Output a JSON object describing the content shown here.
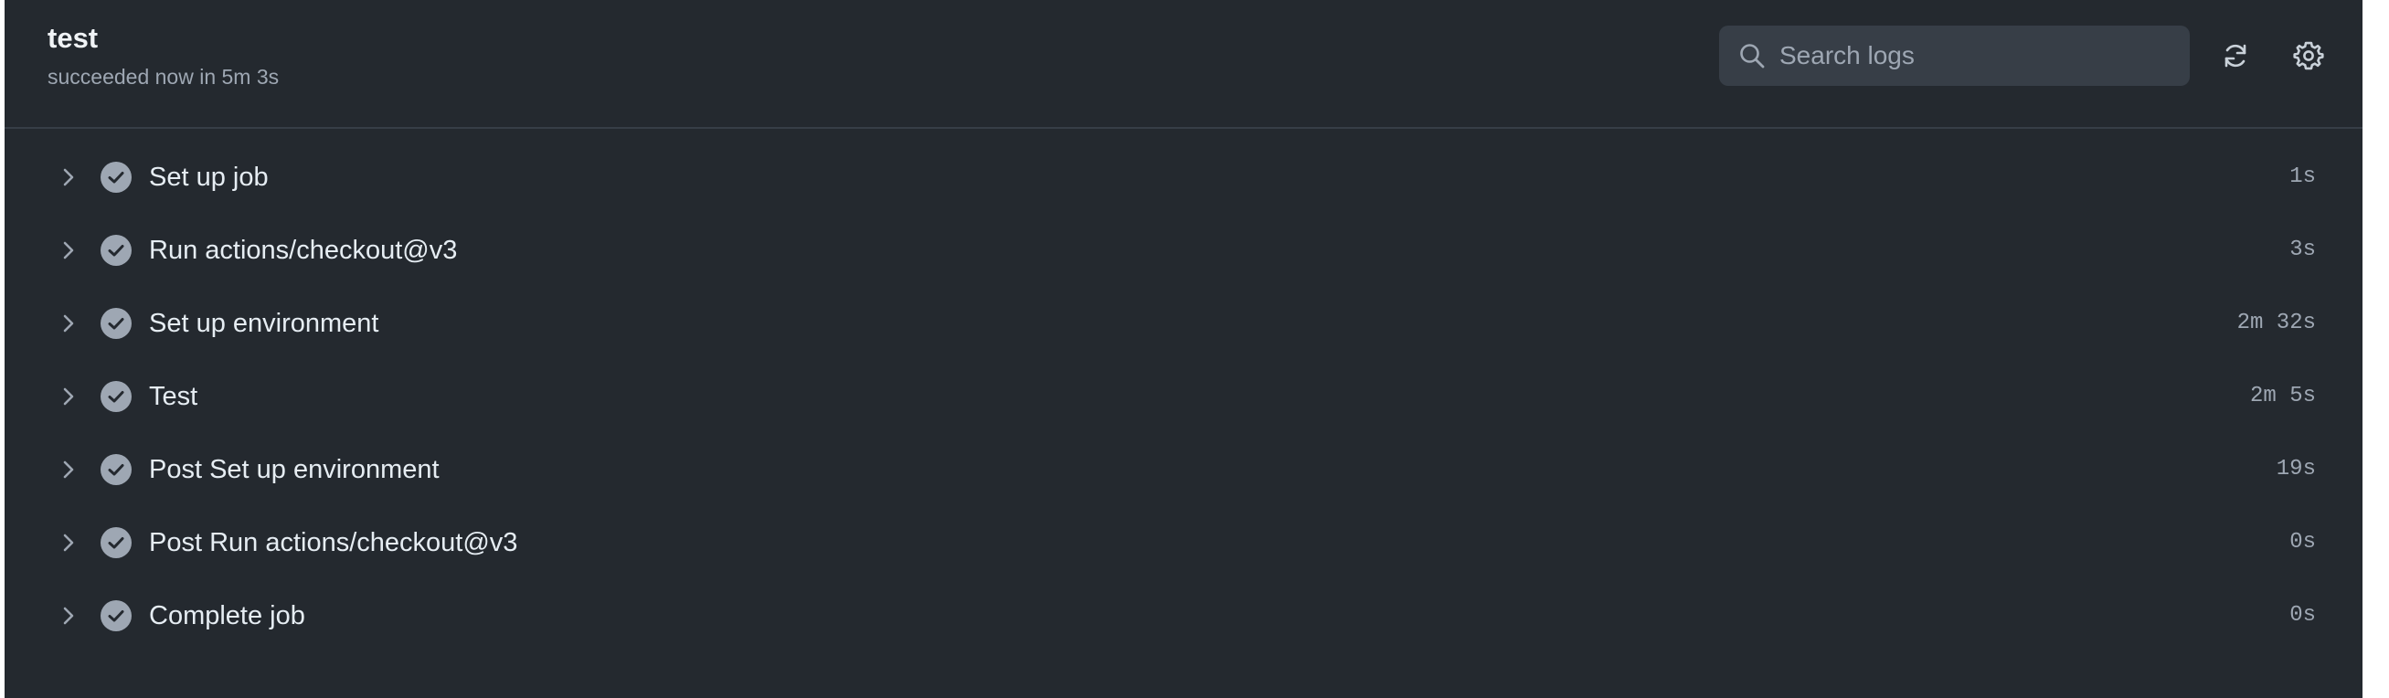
{
  "job": {
    "title": "test",
    "subtitle": "succeeded now in 5m 3s"
  },
  "search": {
    "placeholder": "Search logs",
    "value": "",
    "icon": "search-icon"
  },
  "toolbar": {
    "refresh_icon": "refresh-icon",
    "settings_icon": "gear-icon"
  },
  "colors": {
    "background": "#24292f",
    "text_primary": "#e6edf3",
    "text_muted": "#9ea7b3",
    "success_icon": "#9ea7b3"
  },
  "steps": [
    {
      "name": "Set up job",
      "duration": "1s",
      "status": "success"
    },
    {
      "name": "Run actions/checkout@v3",
      "duration": "3s",
      "status": "success"
    },
    {
      "name": "Set up environment",
      "duration": "2m 32s",
      "status": "success"
    },
    {
      "name": "Test",
      "duration": "2m 5s",
      "status": "success"
    },
    {
      "name": "Post Set up environment",
      "duration": "19s",
      "status": "success"
    },
    {
      "name": "Post Run actions/checkout@v3",
      "duration": "0s",
      "status": "success"
    },
    {
      "name": "Complete job",
      "duration": "0s",
      "status": "success"
    }
  ]
}
